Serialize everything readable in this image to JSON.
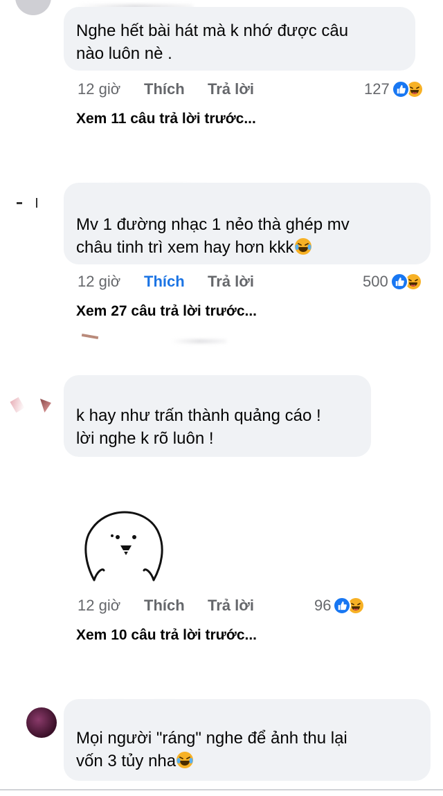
{
  "colors": {
    "bubble": "#f0f2f5",
    "meta_text": "#65676b",
    "like_active": "#1b74e4",
    "like_icon": "#1877f2",
    "haha_icon": "#f7b125"
  },
  "comments": [
    {
      "text_lines": [
        "Nghe hết bài hát mà k nhớ được câu",
        "nào luôn nè ."
      ],
      "time": "12 giờ",
      "like": "Thích",
      "reply": "Trả lời",
      "reaction_count": "127",
      "reactions": [
        "like-icon",
        "haha-icon"
      ],
      "view_replies": "Xem 11 câu trả lời trước..."
    },
    {
      "text_lines": [
        "Mv 1 đường nhạc 1 nẻo thà ghép mv",
        "châu tinh trì xem hay hơn kkk"
      ],
      "trailing_emoji": "laughing-tears-emoji",
      "time": "12 giờ",
      "like": "Thích",
      "liked": true,
      "reply": "Trả lời",
      "reaction_count": "500",
      "reactions": [
        "like-icon",
        "haha-icon"
      ],
      "view_replies": "Xem 27 câu trả lời trước..."
    },
    {
      "text_lines": [
        "k hay như trấn thành quảng cáo !",
        "lời nghe k rõ luôn !"
      ],
      "sticker": "smiling-blob-sticker",
      "time": "12 giờ",
      "like": "Thích",
      "reply": "Trả lời",
      "reaction_count": "96",
      "reactions": [
        "like-icon",
        "haha-icon"
      ],
      "view_replies": "Xem 10 câu trả lời trước..."
    },
    {
      "text_lines": [
        "Mọi người \"ráng\" nghe để ảnh thu lại",
        "vốn 3 tủy nha"
      ],
      "trailing_emoji": "laughing-tears-emoji"
    }
  ]
}
